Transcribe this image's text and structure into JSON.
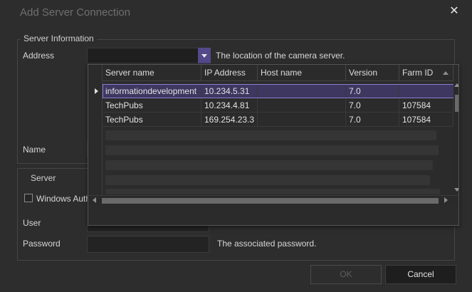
{
  "dialog": {
    "title": "Add Server Connection",
    "close_glyph": "✕"
  },
  "server_info": {
    "legend": "Server Information",
    "address_label": "Address",
    "address_value": "",
    "address_help": "The location of the camera server.",
    "name_label": "Name"
  },
  "server": {
    "legend": "Server",
    "windows_auth_label": "Windows Auth",
    "windows_auth_checked": false,
    "user_label": "User",
    "password_label": "Password",
    "password_help": "The associated password."
  },
  "grid": {
    "columns": [
      "Server name",
      "IP Address",
      "Host name",
      "Version",
      "Farm ID"
    ],
    "rows": [
      {
        "server_name": "informationdevelopment",
        "ip": "10.234.5.31",
        "host": "",
        "version": "7.0",
        "farm_id": ""
      },
      {
        "server_name": "TechPubs",
        "ip": "10.234.4.81",
        "host": "",
        "version": "7.0",
        "farm_id": "107584"
      },
      {
        "server_name": "TechPubs",
        "ip": "169.254.23.3",
        "host": "",
        "version": "7.0",
        "farm_id": "107584"
      }
    ],
    "selected_row": 0
  },
  "buttons": {
    "ok": "OK",
    "cancel": "Cancel"
  },
  "colors": {
    "accent": "#54498a",
    "selection": "#3e3760",
    "background": "#2d2d2d"
  }
}
